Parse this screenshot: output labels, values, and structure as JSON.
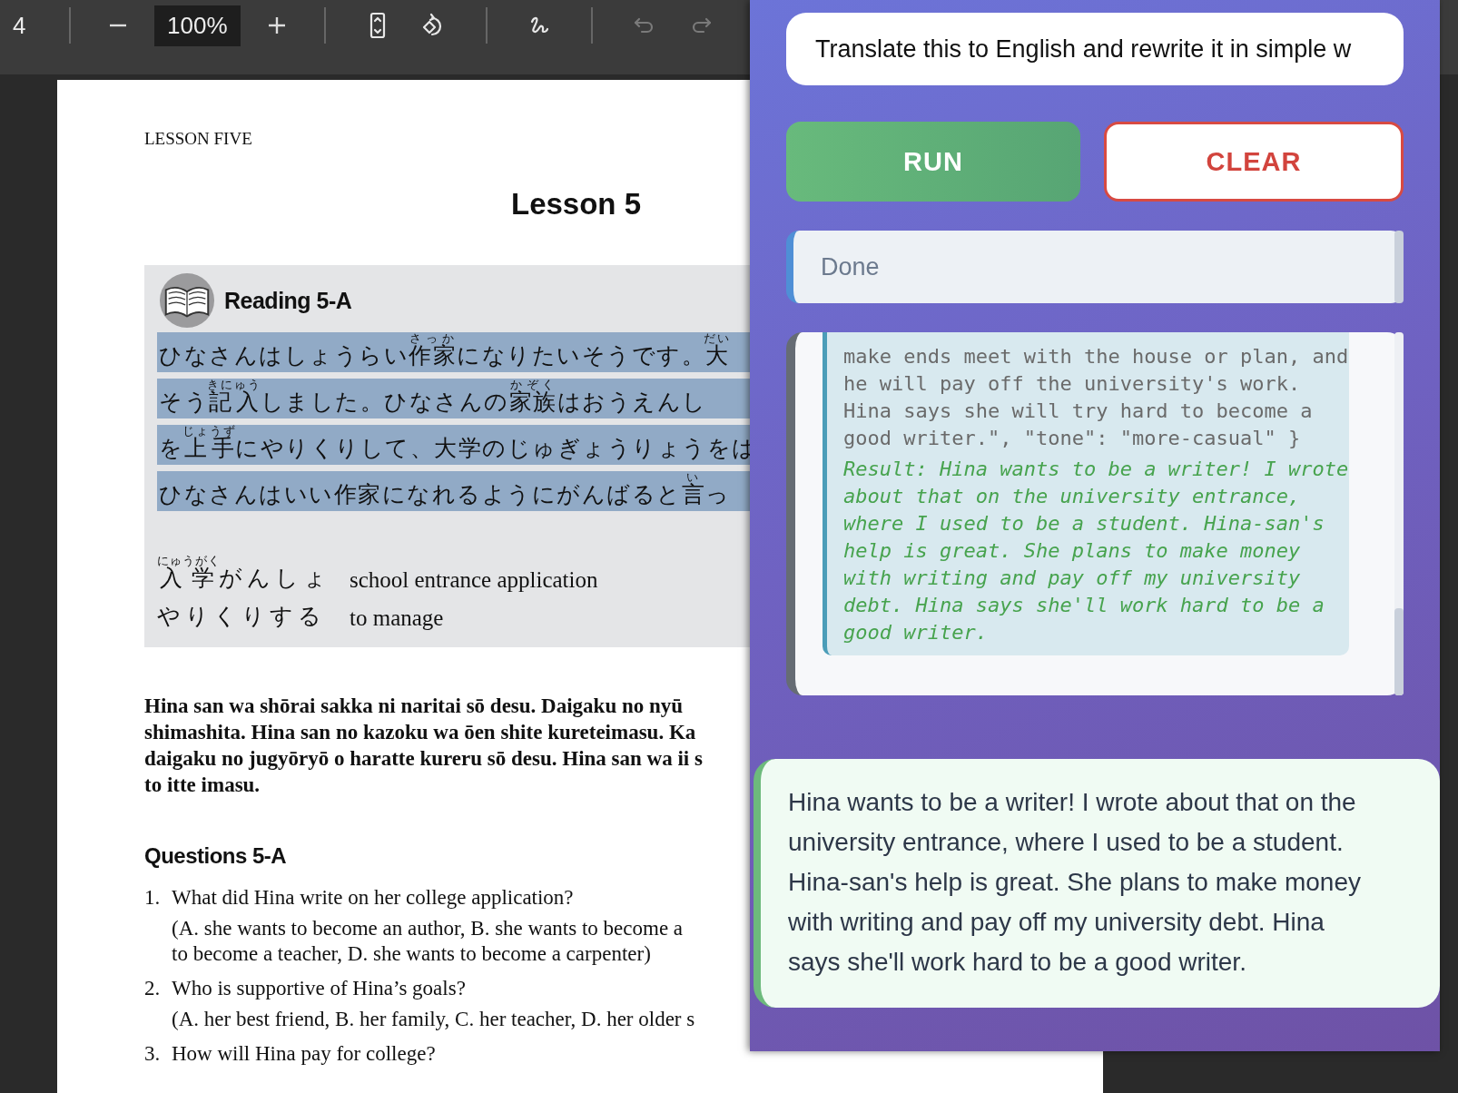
{
  "toolbar": {
    "page": "4",
    "zoom": "100%",
    "tools": [
      {
        "kind": "fit-page",
        "disabled": false
      },
      {
        "kind": "rotate",
        "disabled": false
      },
      {
        "kind": "draw",
        "disabled": false
      },
      {
        "kind": "undo",
        "disabled": true
      },
      {
        "kind": "redo",
        "disabled": true
      }
    ]
  },
  "document": {
    "running_head": "LESSON FIVE",
    "title": "Lesson 5",
    "reading": {
      "title": "Reading 5-A",
      "lines": [
        [
          {
            "text": "ひなさんはしょうらい"
          },
          {
            "text": "作家",
            "ruby": "さっか"
          },
          {
            "text": "になりたいそうです。"
          },
          {
            "text": "大",
            "ruby": "だい"
          }
        ],
        [
          {
            "text": "そう"
          },
          {
            "text": "記入",
            "ruby": "きにゅう"
          },
          {
            "text": "しました。ひなさんの"
          },
          {
            "text": "家族",
            "ruby": "かぞく"
          },
          {
            "text": "はおうえんし"
          }
        ],
        [
          {
            "text": "を"
          },
          {
            "text": "上手",
            "ruby": "じょうず"
          },
          {
            "text": "にやりくりして、大学のじゅぎょうりょうをは"
          }
        ],
        [
          {
            "text": "ひなさんはいい作家になれるようにがんばると"
          },
          {
            "text": "言",
            "ruby": "い"
          },
          {
            "text": "っ"
          }
        ]
      ],
      "vocabulary": [
        {
          "term": [
            {
              "text": "入学",
              "ruby": "にゅうがく"
            },
            {
              "text": "がんしょ"
            }
          ],
          "meaning": "school entrance application"
        },
        {
          "term": [
            {
              "text": "やりくりする"
            }
          ],
          "meaning": "to manage"
        }
      ]
    },
    "romanization": [
      "Hina san wa shōrai sakka ni naritai sō desu. Daigaku no nyū",
      "shimashita. Hina san no kazoku wa ōen shite kureteimasu. Ka",
      "daigaku no jugyōryō o haratte kureru sō desu. Hina san wa ii s",
      "to itte imasu."
    ],
    "questions": {
      "title": "Questions 5-A",
      "items": [
        {
          "number": "1.",
          "text": "What did Hina write on her college application?",
          "options": [
            "(A. she wants to become an author, B. she wants to become a",
            "to become a teacher, D. she wants to become a carpenter)"
          ]
        },
        {
          "number": "2.",
          "text": "Who is supportive of Hina’s goals?",
          "options": [
            "(A. her best friend, B. her family, C. her teacher, D. her older s"
          ]
        },
        {
          "number": "3.",
          "text": "How will Hina pay for college?"
        }
      ]
    }
  },
  "assistant": {
    "prompt": "Translate this to English and rewrite it in simple w",
    "buttons": [
      {
        "kind": "run",
        "label": "RUN"
      },
      {
        "kind": "clear",
        "label": "CLEAR"
      }
    ],
    "status": "Done",
    "output": {
      "code_lines": [
        "make ends meet with the house or plan, and",
        "he will pay off the university's work.",
        "Hina says she will try hard to become a",
        "good writer.\", \"tone\": \"more-casual\" }"
      ],
      "result": "Result: Hina wants to be a writer! I wrote about that on the university entrance, where I used to be a student. Hina-san's help is great. She plans to make money with writing and pay off my university debt. Hina says she'll work hard to be a good writer."
    },
    "answer": "Hina wants to be a writer! I wrote about that on the university entrance, where I used to be a student. Hina-san's help is great. She plans to make money with writing and pay off my university debt. Hina says she'll work hard to be a good writer."
  }
}
